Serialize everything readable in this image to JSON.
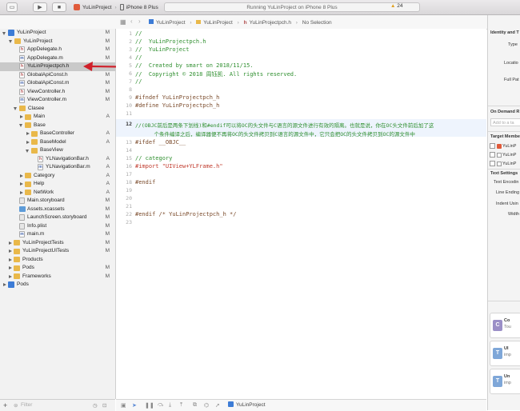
{
  "toolbar": {
    "scheme_name": "YuLinProject",
    "device": "iPhone 8 Plus",
    "status_text": "Running YuLinProject on iPhone 8 Plus",
    "warning_count": "24"
  },
  "jumpbar": {
    "crumbs": [
      "YuLinProject",
      "YuLinProject",
      "YuLinProjectpch.h",
      "No Selection"
    ]
  },
  "navigator": {
    "rows": [
      {
        "label": "YuLinProject",
        "badge": "M"
      },
      {
        "label": "YuLinProject",
        "badge": "M"
      },
      {
        "label": "AppDelegate.h",
        "badge": "M"
      },
      {
        "label": "AppDelegate.m",
        "badge": "M"
      },
      {
        "label": "YuLinProjectpch.h",
        "badge": "A"
      },
      {
        "label": "GlobalApiConst.h",
        "badge": "M"
      },
      {
        "label": "GlobalApiConst.m",
        "badge": "M"
      },
      {
        "label": "ViewController.h",
        "badge": "M"
      },
      {
        "label": "ViewController.m",
        "badge": "M"
      },
      {
        "label": "Clasee",
        "badge": ""
      },
      {
        "label": "Main",
        "badge": "A"
      },
      {
        "label": "Base",
        "badge": ""
      },
      {
        "label": "BaseController",
        "badge": "A"
      },
      {
        "label": "BaseModel",
        "badge": "A"
      },
      {
        "label": "BaseView",
        "badge": ""
      },
      {
        "label": "YLNavigationBar.h",
        "badge": "A"
      },
      {
        "label": "YLNavigationBar.m",
        "badge": "A"
      },
      {
        "label": "Category",
        "badge": "A"
      },
      {
        "label": "Help",
        "badge": "A"
      },
      {
        "label": "NetWork",
        "badge": "A"
      },
      {
        "label": "Main.storyboard",
        "badge": "M"
      },
      {
        "label": "Assets.xcassets",
        "badge": "M"
      },
      {
        "label": "LaunchScreen.storyboard",
        "badge": "M"
      },
      {
        "label": "Info.plist",
        "badge": "M"
      },
      {
        "label": "main.m",
        "badge": "M"
      },
      {
        "label": "YuLinProjectTests",
        "badge": "M"
      },
      {
        "label": "YuLinProjectUITests",
        "badge": "M"
      },
      {
        "label": "Products",
        "badge": ""
      },
      {
        "label": "Pods",
        "badge": "M"
      },
      {
        "label": "Frameworks",
        "badge": "M"
      },
      {
        "label": "Pods",
        "badge": ""
      }
    ],
    "filter_placeholder": "Filter"
  },
  "editor": {
    "line_numbers": [
      "1",
      "2",
      "3",
      "4",
      "5",
      "6",
      "7",
      "8",
      "9",
      "10",
      "11",
      "12",
      "13",
      "14",
      "15",
      "16",
      "17",
      "18",
      "19",
      "20",
      "21",
      "22",
      "23"
    ],
    "lines": [
      "//",
      "//  YuLinProjectpch.h",
      "//  YuLinProject",
      "//",
      "//  Created by smart on 2018/11/15.",
      "//  Copyright © 2018 周钰凯. All rights reserved.",
      "//",
      "",
      "#ifndef YuLinProjectpch_h",
      "#define YuLinProjectpch_h",
      "",
      "//(OBJC前后是两条下划线)和#endif可以将OC的头文件与C语言的源文件进行有效的隔离。也就是说，你在OC头文件前后加了这",
      "      个条件编译之后，编译器便不再将OC的头文件拷贝到C语言的源文件中，它只会把OC的头文件拷贝到OC的源文件中",
      "#ifdef __OBJC__",
      "",
      "// category",
      "#import \"UIView+YLFrame.h\"",
      "",
      "#endif",
      "",
      "",
      "",
      "#endif /* YuLinProjectpch_h */",
      ""
    ],
    "footer_target": "YuLinProject"
  },
  "inspector": {
    "identity_title": "Identity and T",
    "type_label": "Type",
    "location_label": "Locatio",
    "fullpath_label": "Full Pat",
    "on_demand_title": "On Demand R",
    "on_demand_placeholder": "Add to a ta",
    "target_title": "Target Membe",
    "targets": [
      "YuLinP",
      "YuLinP",
      "YuLinP"
    ],
    "text_settings_title": "Text Settings",
    "text_encoding": "Text Encodin",
    "line_endings": "Line Ending",
    "indent_using": "Indent Usin",
    "widths": "Width",
    "library": [
      {
        "title": "Co",
        "sub": "Tou",
        "icon": "C"
      },
      {
        "title": "UI",
        "sub": "imp",
        "icon": "T"
      },
      {
        "title": "Un",
        "sub": "imp",
        "icon": "T"
      }
    ]
  },
  "colors": {
    "comment": "#2f8f2f",
    "preprocessor": "#7a4a2a",
    "string": "#c0392b",
    "arrow": "#d0202a",
    "selection": "#c9c9c9"
  }
}
